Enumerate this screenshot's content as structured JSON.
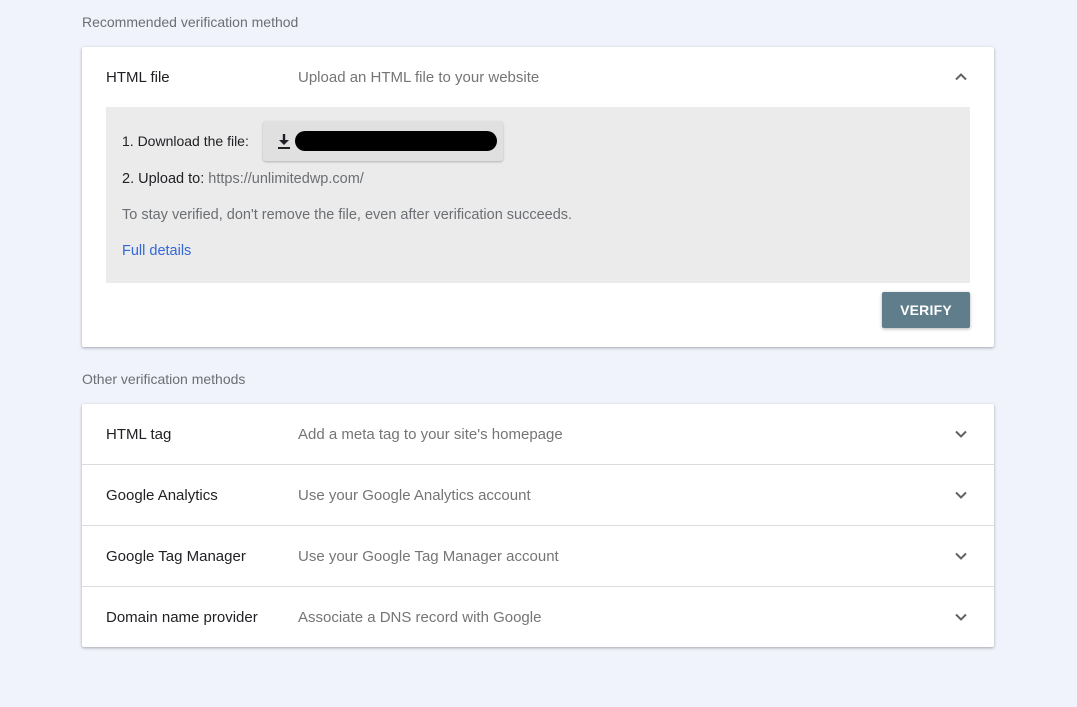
{
  "recommended": {
    "section_label": "Recommended verification method",
    "method": {
      "title": "HTML file",
      "description": "Upload an HTML file to your website",
      "expanded": true,
      "step1_label": "1. Download the file:",
      "download_icon": "download-icon",
      "step2_label": "2. Upload to:",
      "step2_url": "https://unlimitedwp.com/",
      "note": "To stay verified, don't remove the file, even after verification succeeds.",
      "full_details_link": "Full details",
      "verify_button": "VERIFY"
    }
  },
  "other": {
    "section_label": "Other verification methods",
    "methods": [
      {
        "title": "HTML tag",
        "description": "Add a meta tag to your site's homepage"
      },
      {
        "title": "Google Analytics",
        "description": "Use your Google Analytics account"
      },
      {
        "title": "Google Tag Manager",
        "description": "Use your Google Tag Manager account"
      },
      {
        "title": "Domain name provider",
        "description": "Associate a DNS record with Google"
      }
    ]
  },
  "colors": {
    "background": "#f0f3fb",
    "verify_button": "#607d8b",
    "link": "#3367d6",
    "expanded_panel": "#ebebeb"
  }
}
